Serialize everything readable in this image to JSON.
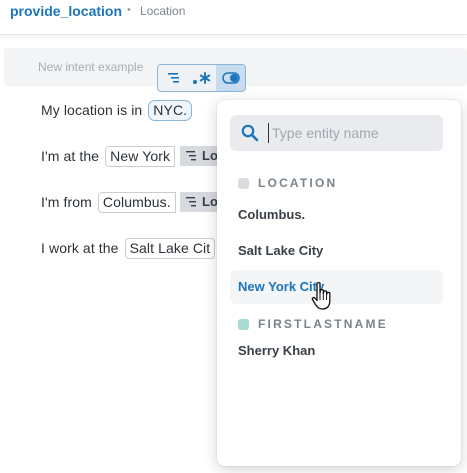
{
  "header": {
    "intent_name": "provide_location",
    "separator": "•",
    "breadcrumb": "Location"
  },
  "new_example": {
    "placeholder": "New intent example"
  },
  "examples": [
    {
      "prefix": "My location is in",
      "entity": "NYC.",
      "tag": ""
    },
    {
      "prefix": "I'm at the",
      "entity": "New York",
      "tag": "Lo"
    },
    {
      "prefix": "I'm from",
      "entity": "Columbus.",
      "tag": "Lo"
    },
    {
      "prefix": "I work at the",
      "entity": "Salt Lake Cit",
      "tag": ""
    }
  ],
  "popup": {
    "search_placeholder": "Type entity name",
    "groups": [
      {
        "label": "LOCATION",
        "color": "#d8dce1",
        "options": [
          "Columbus.",
          "Salt Lake City",
          "New York City"
        ]
      },
      {
        "label": "FIRSTLASTNAME",
        "color": "#a6dcd4",
        "options": [
          "Sherry Khan"
        ]
      }
    ]
  },
  "colors": {
    "accent": "#1b75bb",
    "text": "#2c3238"
  }
}
